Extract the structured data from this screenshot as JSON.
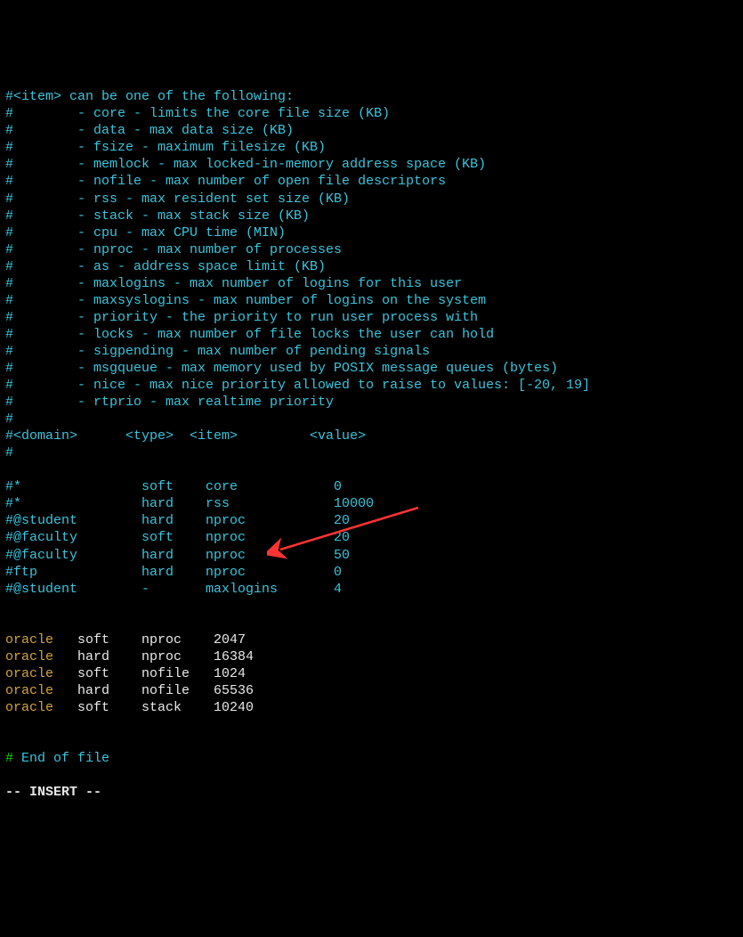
{
  "comment_lines": [
    "#<item> can be one of the following:",
    "#        - core - limits the core file size (KB)",
    "#        - data - max data size (KB)",
    "#        - fsize - maximum filesize (KB)",
    "#        - memlock - max locked-in-memory address space (KB)",
    "#        - nofile - max number of open file descriptors",
    "#        - rss - max resident set size (KB)",
    "#        - stack - max stack size (KB)",
    "#        - cpu - max CPU time (MIN)",
    "#        - nproc - max number of processes",
    "#        - as - address space limit (KB)",
    "#        - maxlogins - max number of logins for this user",
    "#        - maxsyslogins - max number of logins on the system",
    "#        - priority - the priority to run user process with",
    "#        - locks - max number of file locks the user can hold",
    "#        - sigpending - max number of pending signals",
    "#        - msgqueue - max memory used by POSIX message queues (bytes)",
    "#        - nice - max nice priority allowed to raise to values: [-20, 19]",
    "#        - rtprio - max realtime priority",
    "#",
    "#<domain>      <type>  <item>         <value>",
    "#",
    "",
    "#*               soft    core            0",
    "#*               hard    rss             10000",
    "#@student        hard    nproc           20",
    "#@faculty        soft    nproc           20",
    "#@faculty        hard    nproc           50",
    "#ftp             hard    nproc           0",
    "#@student        -       maxlogins       4"
  ],
  "oracle_lines": [
    {
      "user": "oracle",
      "rest": "   soft    nproc    2047"
    },
    {
      "user": "oracle",
      "rest": "   hard    nproc    16384"
    },
    {
      "user": "oracle",
      "rest": "   soft    nofile   1024"
    },
    {
      "user": "oracle",
      "rest": "   hard    nofile   65536"
    },
    {
      "user": "oracle",
      "rest": "   soft    stack    10240"
    }
  ],
  "end_line": {
    "hash": "#",
    "text": " End of file"
  },
  "mode_line": "-- INSERT --"
}
